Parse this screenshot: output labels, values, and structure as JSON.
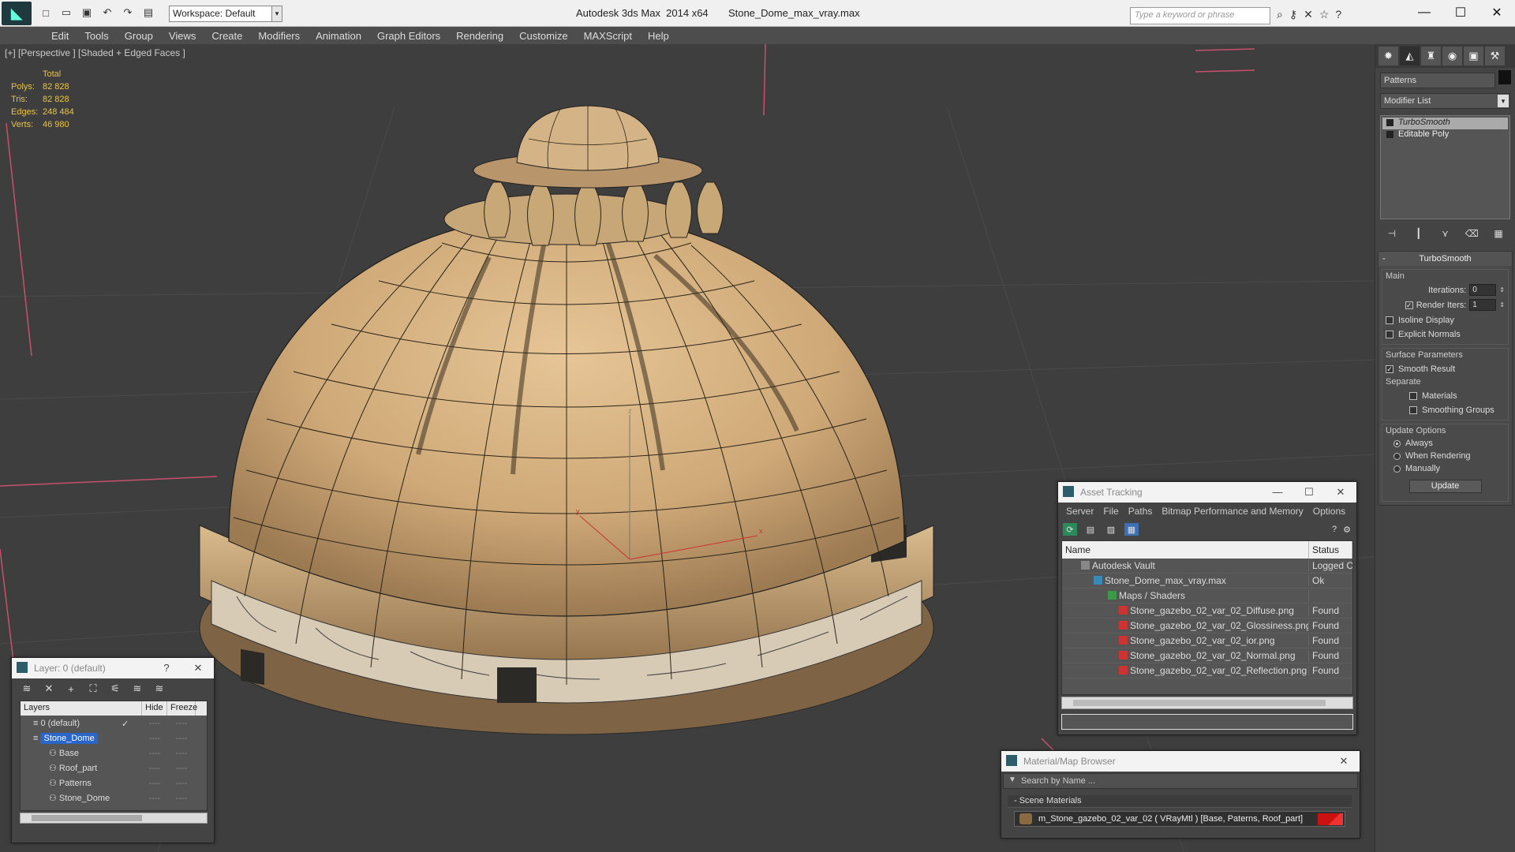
{
  "titlebar": {
    "workspace": "Workspace: Default",
    "title": "Autodesk 3ds Max  2014 x64       Stone_Dome_max_vray.max",
    "search_placeholder": "Type a keyword or phrase"
  },
  "menu": [
    "Edit",
    "Tools",
    "Group",
    "Views",
    "Create",
    "Modifiers",
    "Animation",
    "Graph Editors",
    "Rendering",
    "Customize",
    "MAXScript",
    "Help"
  ],
  "viewport": {
    "label": "[+] [Perspective ] [Shaded + Edged Faces ]",
    "stats": {
      "header": "Total",
      "rows": [
        {
          "k": "Polys:",
          "v": "82 828"
        },
        {
          "k": "Tris:",
          "v": "82 828"
        },
        {
          "k": "Edges:",
          "v": "248 484"
        },
        {
          "k": "Verts:",
          "v": "46 980"
        }
      ]
    }
  },
  "command_panel": {
    "object_name": "Patterns",
    "modifier_list": "Modifier List",
    "stack": [
      "TurboSmooth",
      "Editable Poly"
    ],
    "rollout": {
      "title": "TurboSmooth",
      "main_label": "Main",
      "iterations_label": "Iterations:",
      "iterations_value": "0",
      "render_iters_label": "Render Iters:",
      "render_iters_value": "1",
      "isoline": "Isoline Display",
      "explicit_normals": "Explicit Normals",
      "surface_params": "Surface Parameters",
      "smooth_result": "Smooth Result",
      "separate": "Separate",
      "materials": "Materials",
      "smoothing_groups": "Smoothing Groups",
      "update_options": "Update Options",
      "always": "Always",
      "when_rendering": "When Rendering",
      "manually": "Manually",
      "update_button": "Update"
    }
  },
  "layer_panel": {
    "title": "Layer: 0 (default)",
    "help": "?",
    "columns": [
      "Layers",
      "Hide",
      "Freeze"
    ],
    "rows": [
      {
        "name": "0 (default)",
        "check": "✓"
      },
      {
        "name": "Stone_Dome",
        "check": ""
      },
      {
        "name": "Base",
        "check": ""
      },
      {
        "name": "Roof_part",
        "check": ""
      },
      {
        "name": "Patterns",
        "check": ""
      },
      {
        "name": "Stone_Dome",
        "check": ""
      }
    ],
    "dash": "----"
  },
  "asset_panel": {
    "title": "Asset Tracking",
    "menu": [
      "Server",
      "File",
      "Paths",
      "Bitmap Performance and Memory",
      "Options"
    ],
    "columns": [
      "Name",
      "Status"
    ],
    "rows": [
      {
        "name": "Autodesk Vault",
        "status": "Logged O"
      },
      {
        "name": "Stone_Dome_max_vray.max",
        "status": "Ok"
      },
      {
        "name": "Maps / Shaders",
        "status": ""
      },
      {
        "name": "Stone_gazebo_02_var_02_Diffuse.png",
        "status": "Found"
      },
      {
        "name": "Stone_gazebo_02_var_02_Glossiness.png",
        "status": "Found"
      },
      {
        "name": "Stone_gazebo_02_var_02_ior.png",
        "status": "Found"
      },
      {
        "name": "Stone_gazebo_02_var_02_Normal.png",
        "status": "Found"
      },
      {
        "name": "Stone_gazebo_02_var_02_Reflection.png",
        "status": "Found"
      }
    ]
  },
  "material_panel": {
    "title": "Material/Map Browser",
    "search_placeholder": "Search by Name ...",
    "section": "- Scene Materials",
    "material": "m_Stone_gazebo_02_var_02  ( VRayMtl )  [Base, Paterns, Roof_part]"
  },
  "colors": {
    "viewport_bg": "#3e3e3e",
    "dome": "#cfa978",
    "stats": "#e8c34a",
    "selection": "#2966c8"
  }
}
